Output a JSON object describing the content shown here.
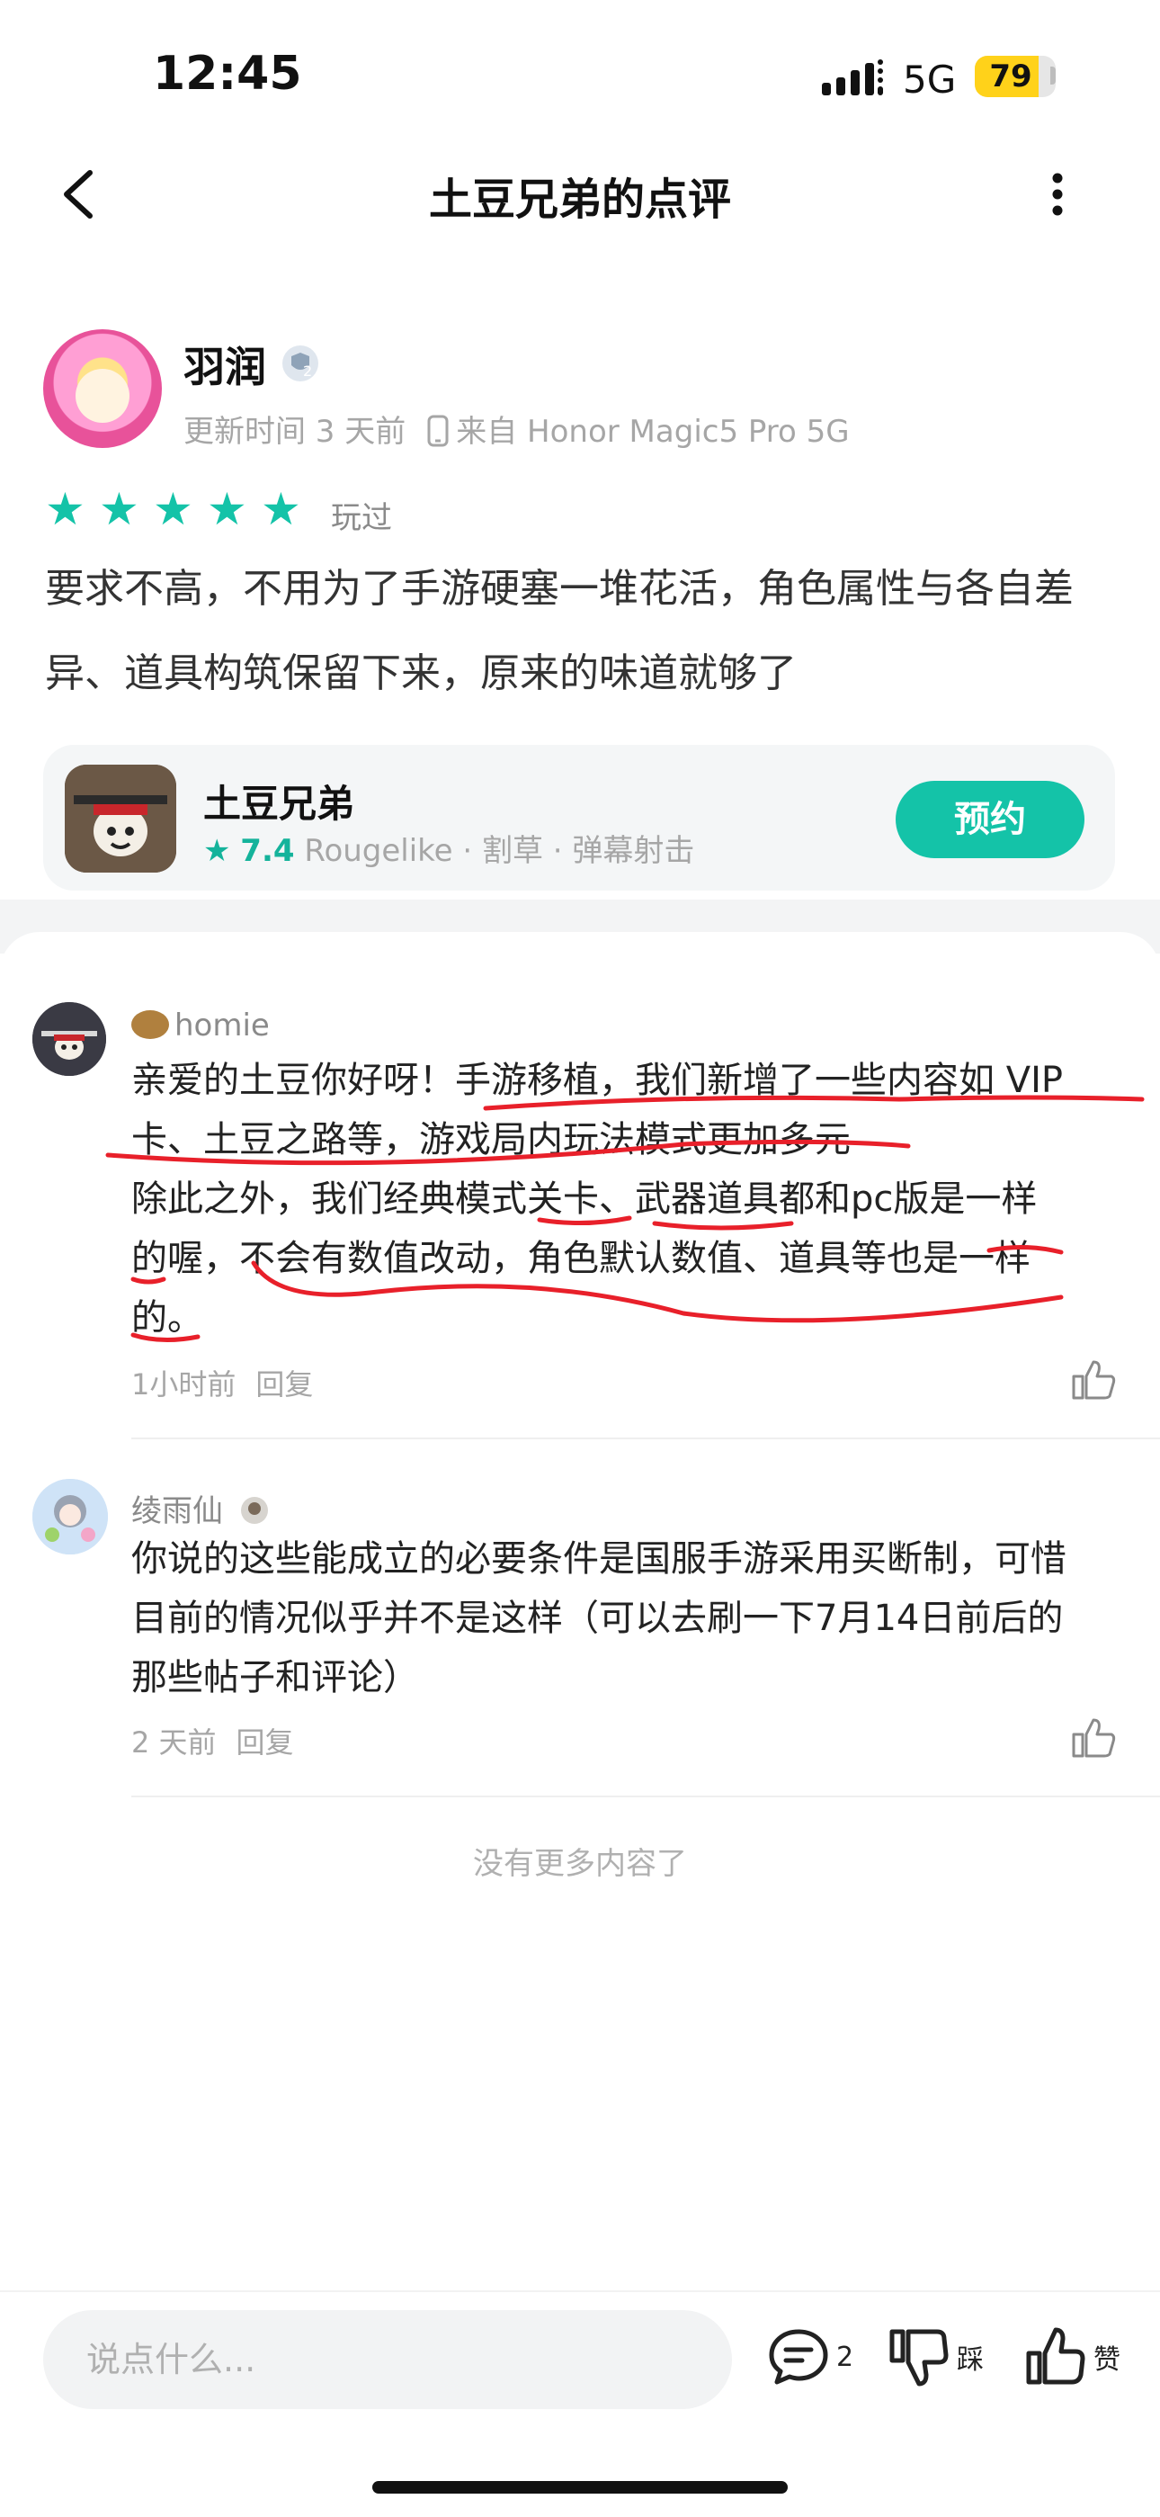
{
  "status_bar": {
    "time": "12:45",
    "network": "5G",
    "battery": "79"
  },
  "header": {
    "title": "土豆兄弟的点评"
  },
  "review": {
    "user_name": "羽润",
    "updated_label": "更新时间 3 天前",
    "device_label": "来自 Honor Magic5 Pro 5G",
    "rating": 5,
    "played_label": "玩过",
    "text": "要求不高，不用为了手游硬塞一堆花活，角色属性与各自差异、道具构筑保留下来，原来的味道就够了"
  },
  "game": {
    "name": "土豆兄弟",
    "score": "7.4",
    "tags": "Rougelike · 割草 · 弹幕射击",
    "reserve_label": "预约"
  },
  "comments": [
    {
      "user": "homie",
      "lines": [
        "亲爱的土豆你好呀！手游移植，我们新增了一些内容如 VIP",
        "卡、土豆之路等，游戏局内玩法模式更加多元",
        "除此之外，我们经典模式关卡、武器道具都和pc版是一样",
        "的喔，不会有数值改动，角色默认数值、道具等也是一样",
        "的。"
      ],
      "time": "1小时前",
      "reply_label": "回复"
    },
    {
      "user": "绫雨仙",
      "lines": [
        "你说的这些能成立的必要条件是国服手游采用买断制，可惜",
        "目前的情况似乎并不是这样（可以去刷一下7月14日前后的",
        "那些帖子和评论）"
      ],
      "time": "2 天前",
      "reply_label": "回复"
    }
  ],
  "footer_note": "没有更多内容了",
  "bottom_bar": {
    "input_placeholder": "说点什么...",
    "comment_count": "2",
    "dislike_label": "踩",
    "like_label": "赞"
  },
  "colors": {
    "accent": "#14c3a8",
    "battery": "#ffd21a",
    "annotation": "#e8202a"
  },
  "icons": [
    "signal-icon",
    "battery-icon",
    "back-arrow-icon",
    "more-vertical-icon",
    "level-badge-icon",
    "device-icon",
    "star-icon",
    "thumb-up-icon",
    "thumb-down-icon",
    "comment-bubble-icon"
  ]
}
